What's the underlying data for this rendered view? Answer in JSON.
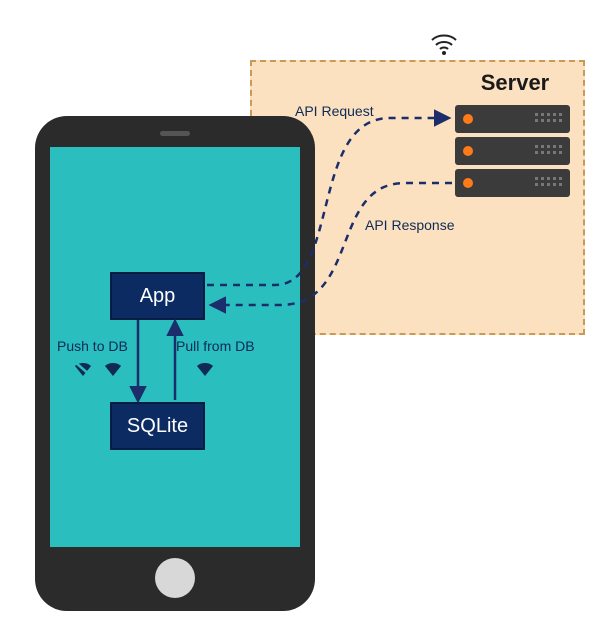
{
  "diagram": {
    "server_title": "Server",
    "app_box": "App",
    "sqlite_box": "SQLite",
    "api_request_label": "API Request",
    "api_response_label": "API Response",
    "push_label": "Push to DB",
    "pull_label": "Pull from DB"
  },
  "colors": {
    "phone_body": "#2b2b2b",
    "phone_screen": "#2bbebe",
    "box_bg": "#0b2b62",
    "server_panel_bg": "#f8cda0",
    "server_panel_border": "#c89a55",
    "arrow": "#1b2d6b",
    "server_led": "#ff7a1a"
  }
}
